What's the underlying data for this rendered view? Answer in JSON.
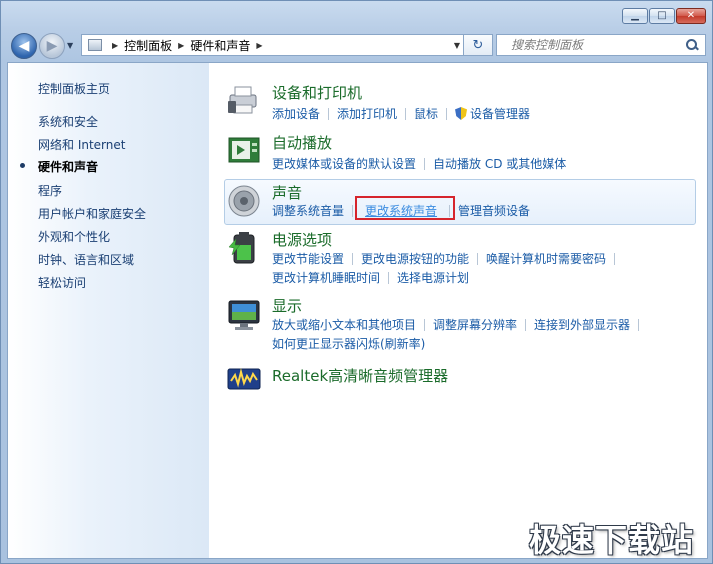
{
  "window": {
    "minimize_icon": "minimize-icon",
    "maximize_icon": "maximize-icon",
    "close_icon": "close-icon"
  },
  "toolbar": {
    "back_glyph": "◀",
    "forward_glyph": "▶",
    "dropdown_glyph": "▼",
    "breadcrumb": [
      "控制面板",
      "硬件和声音"
    ],
    "crumb_sep": "▶",
    "refresh_glyph": "↻",
    "search_placeholder": "搜索控制面板"
  },
  "sidebar": {
    "items": [
      {
        "label": "控制面板主页",
        "current": false
      },
      {
        "label": "系统和安全",
        "current": false
      },
      {
        "label": "网络和 Internet",
        "current": false
      },
      {
        "label": "硬件和声音",
        "current": true
      },
      {
        "label": "程序",
        "current": false
      },
      {
        "label": "用户帐户和家庭安全",
        "current": false
      },
      {
        "label": "外观和个性化",
        "current": false
      },
      {
        "label": "时钟、语言和区域",
        "current": false
      },
      {
        "label": "轻松访问",
        "current": false
      }
    ]
  },
  "categories": {
    "devices": {
      "title": "设备和打印机",
      "icon": "printer-icon",
      "links": [
        "添加设备",
        "添加打印机",
        "鼠标",
        "设备管理器"
      ]
    },
    "autoplay": {
      "title": "自动播放",
      "icon": "autoplay-icon",
      "links": [
        "更改媒体或设备的默认设置",
        "自动播放 CD 或其他媒体"
      ]
    },
    "sound": {
      "title": "声音",
      "icon": "speaker-icon",
      "links": [
        "调整系统音量",
        "更改系统声音",
        "管理音频设备"
      ]
    },
    "power": {
      "title": "电源选项",
      "icon": "battery-icon",
      "links_row1": [
        "更改节能设置",
        "更改电源按钮的功能",
        "唤醒计算机时需要密码"
      ],
      "links_row2": [
        "更改计算机睡眠时间",
        "选择电源计划"
      ]
    },
    "display": {
      "title": "显示",
      "icon": "monitor-icon",
      "links_row1": [
        "放大或缩小文本和其他项目",
        "调整屏幕分辨率",
        "连接到外部显示器"
      ],
      "links_row2": [
        "如何更正显示器闪烁(刷新率)"
      ]
    },
    "realtek": {
      "title": "Realtek高清晰音频管理器",
      "icon": "realtek-audio-icon"
    }
  },
  "watermark": "极速下载站",
  "colors": {
    "link": "#1a5ba6",
    "title": "#1a6b2a",
    "highlight_box": "#d6242c"
  }
}
